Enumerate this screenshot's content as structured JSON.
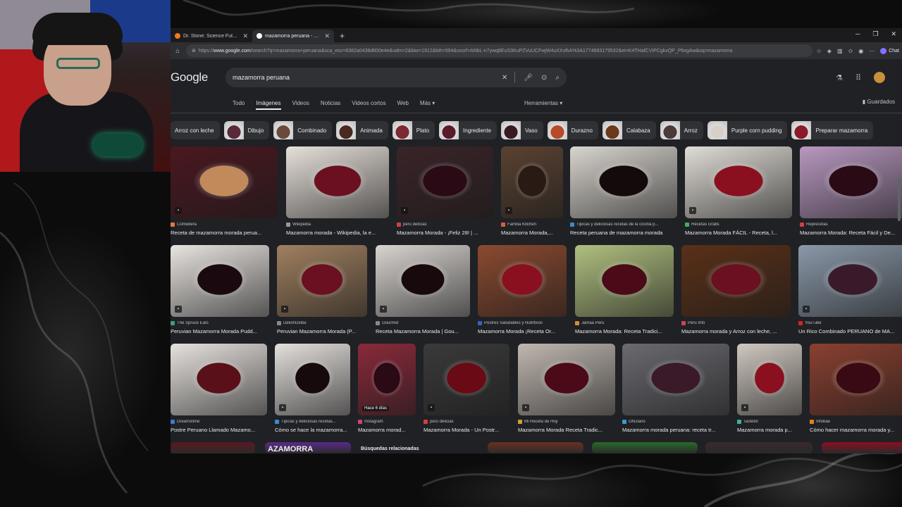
{
  "browser": {
    "tabs": [
      {
        "title": "Dr. Stone: Science Future Cap 1 - ",
        "active": false
      },
      {
        "title": "mazamorra peruana - Buscar con ",
        "active": true
      }
    ],
    "new_tab_icon": "plus-icon",
    "address": {
      "scheme": "https://",
      "host": "www.google.com",
      "path": "/search?q=mazamorra+peruana&sca_esv=8382a0438d800e4e&udm=2&biw=1912&bih=994&sxsrf=ANbL-n7ywq8EuS3KuPZVuUCFwjW4uXXvlhA%3A1774683179532&ei=K4THafCVIPCgkvQP_P6xgAw&oq=mazamorra"
    },
    "chat_label": "Chat"
  },
  "google": {
    "logo": "Google",
    "query": "mazamorra peruana",
    "nav": [
      "Todo",
      "Imágenes",
      "Videos",
      "Noticias",
      "Videos cortos",
      "Web",
      "Más"
    ],
    "active_nav": "Imágenes",
    "tools_label": "Herramientas",
    "saved_label": "Guardados",
    "chips": [
      {
        "label": "Arroz con leche",
        "color": ""
      },
      {
        "label": "Dibujo",
        "color": "#5a2a3a"
      },
      {
        "label": "Combinado",
        "color": "#6a4a3a"
      },
      {
        "label": "Animada",
        "color": "#4a2a20"
      },
      {
        "label": "Plato",
        "color": "#7a2a30"
      },
      {
        "label": "Ingrediente",
        "color": "#5a1a2a"
      },
      {
        "label": "Vaso",
        "color": "#3a1a22"
      },
      {
        "label": "Durazno",
        "color": "#b84a2a"
      },
      {
        "label": "Calabaza",
        "color": "#6a3a1a"
      },
      {
        "label": "Arroz",
        "color": "#4a3a3a"
      },
      {
        "label": "Purple corn pudding",
        "color": "#d8d0c8"
      },
      {
        "label": "Preparar mazamorra",
        "color": "#8a1a2a"
      }
    ],
    "rows": [
      [
        {
          "source": "Comedera",
          "caption": "Receta de mazamorra morada perua...",
          "color": "#4a1820",
          "accent": "#c08a5a",
          "sc": "#e07a3a",
          "icon": true
        },
        {
          "source": "Wikipedia",
          "caption": "Mazamorra morada - Wikipedia, la e...",
          "color": "#e6e0da",
          "accent": "#6a1020",
          "sc": "#999999",
          "icon": false
        },
        {
          "source": "peru delicias",
          "caption": "Mazamorra Morada - ¡Feliz 28! | ...",
          "color": "#3a2428",
          "accent": "#2a0a14",
          "sc": "#d04040",
          "icon": true
        },
        {
          "source": "Familia Kitchen",
          "caption": "Mazamorra Morada,...",
          "color": "#5a4232",
          "accent": "#2a1a14",
          "sc": "#d06040",
          "icon": true
        },
        {
          "source": "Tipicas y deliciosas recetas de la cocina p...",
          "caption": "Receta peruana de mazamorra morada",
          "color": "#d8d4ce",
          "accent": "#140a0c",
          "sc": "#3a8ad0",
          "icon": false
        },
        {
          "source": "Recetas Gratis",
          "caption": "Mazamorra Morada FÁCIL - Receta, l...",
          "color": "#e0dcd6",
          "accent": "#8a1020",
          "sc": "#3ab060",
          "icon": true
        },
        {
          "source": "Reprecetas",
          "caption": "Mazamorra Morada: Receta Fácil y De...",
          "color": "#b898c0",
          "accent": "#2a0a14",
          "sc": "#d04040",
          "icon": false
        }
      ],
      [
        {
          "source": "The Spruce Eats",
          "caption": "Peruvian Mazamorra Morada Pudd...",
          "color": "#e8e4e0",
          "accent": "#1a0a10",
          "sc": "#3aa080",
          "icon": true
        },
        {
          "source": "DelishGlobe",
          "caption": "Peruvian Mazamorra Morada (P...",
          "color": "#a08060",
          "accent": "#6a1020",
          "sc": "#888888",
          "icon": true
        },
        {
          "source": "Gourmet",
          "caption": "Receta Mazamorra Morada | Gou...",
          "color": "#d8d4d0",
          "accent": "#180a0c",
          "sc": "#888888",
          "icon": true
        },
        {
          "source": "Postres Saludables y Nutritivos",
          "caption": "Mazamorra Morada ¡Receta Or...",
          "color": "#8a4a30",
          "accent": "#8a1020",
          "sc": "#3a60c0",
          "icon": false
        },
        {
          "source": "Jamaa Perú",
          "caption": "Mazamorra Morada: Receta Tradici...",
          "color": "#b0c080",
          "accent": "#4a0a18",
          "sc": "#d09030",
          "icon": false
        },
        {
          "source": "Perú Info",
          "caption": "Mazamorra morada y Arroz con leche, ...",
          "color": "#5a3018",
          "accent": "#6a1020",
          "sc": "#d04060",
          "icon": false
        },
        {
          "source": "YouTube",
          "caption": "Un Rico Combinado PERUANO de MA...",
          "color": "#8a98a8",
          "accent": "#3a1a2a",
          "sc": "#e02020",
          "icon": true
        }
      ],
      [
        {
          "source": "Dreamstime",
          "caption": "Postre Peruano Llamado Mazamo...",
          "color": "#e6e2de",
          "accent": "#5a1018",
          "sc": "#3a7ad0",
          "icon": false
        },
        {
          "source": "Tipicas y deliciosas recetas...",
          "caption": "Cómo se hace la mazamorra...",
          "color": "#e4e0dc",
          "accent": "#160a0c",
          "sc": "#3a8ad0",
          "icon": true
        },
        {
          "source": "Instagram",
          "caption": "Mazamorra morad...",
          "color": "#8a2a3a",
          "accent": "#2a0a14",
          "sc": "#d04080",
          "icon": false,
          "tag": "Hace 6 días"
        },
        {
          "source": "peru delicias",
          "caption": "Mazamorra Morada - Un Postr...",
          "color": "#3a3a3a",
          "accent": "#6a0a14",
          "sc": "#d04040",
          "icon": true
        },
        {
          "source": "Mi Receta de Hoy",
          "caption": "Mazamorra Morada Receta Tradic...",
          "color": "#c0b8b0",
          "accent": "#4a0a18",
          "sc": "#d0a030",
          "icon": true
        },
        {
          "source": "OhDiario",
          "caption": "Mazamorra morada peruana: receta tr...",
          "color": "#6a6a70",
          "accent": "#3a1a28",
          "sc": "#3a9ad0",
          "icon": false
        },
        {
          "source": "Tastefol",
          "caption": "Mazamorra morada p...",
          "color": "#d0c8c0",
          "accent": "#8a1020",
          "sc": "#3ab0a0",
          "icon": true
        },
        {
          "source": "Infobae",
          "caption": "Cómo hacer mazamorra morada y...",
          "color": "#8a4030",
          "accent": "#3a0a14",
          "sc": "#e08020",
          "icon": false
        }
      ]
    ],
    "related_label": "Búsquedas relacionadas",
    "partial_banner_text": "AZAMORRA"
  }
}
